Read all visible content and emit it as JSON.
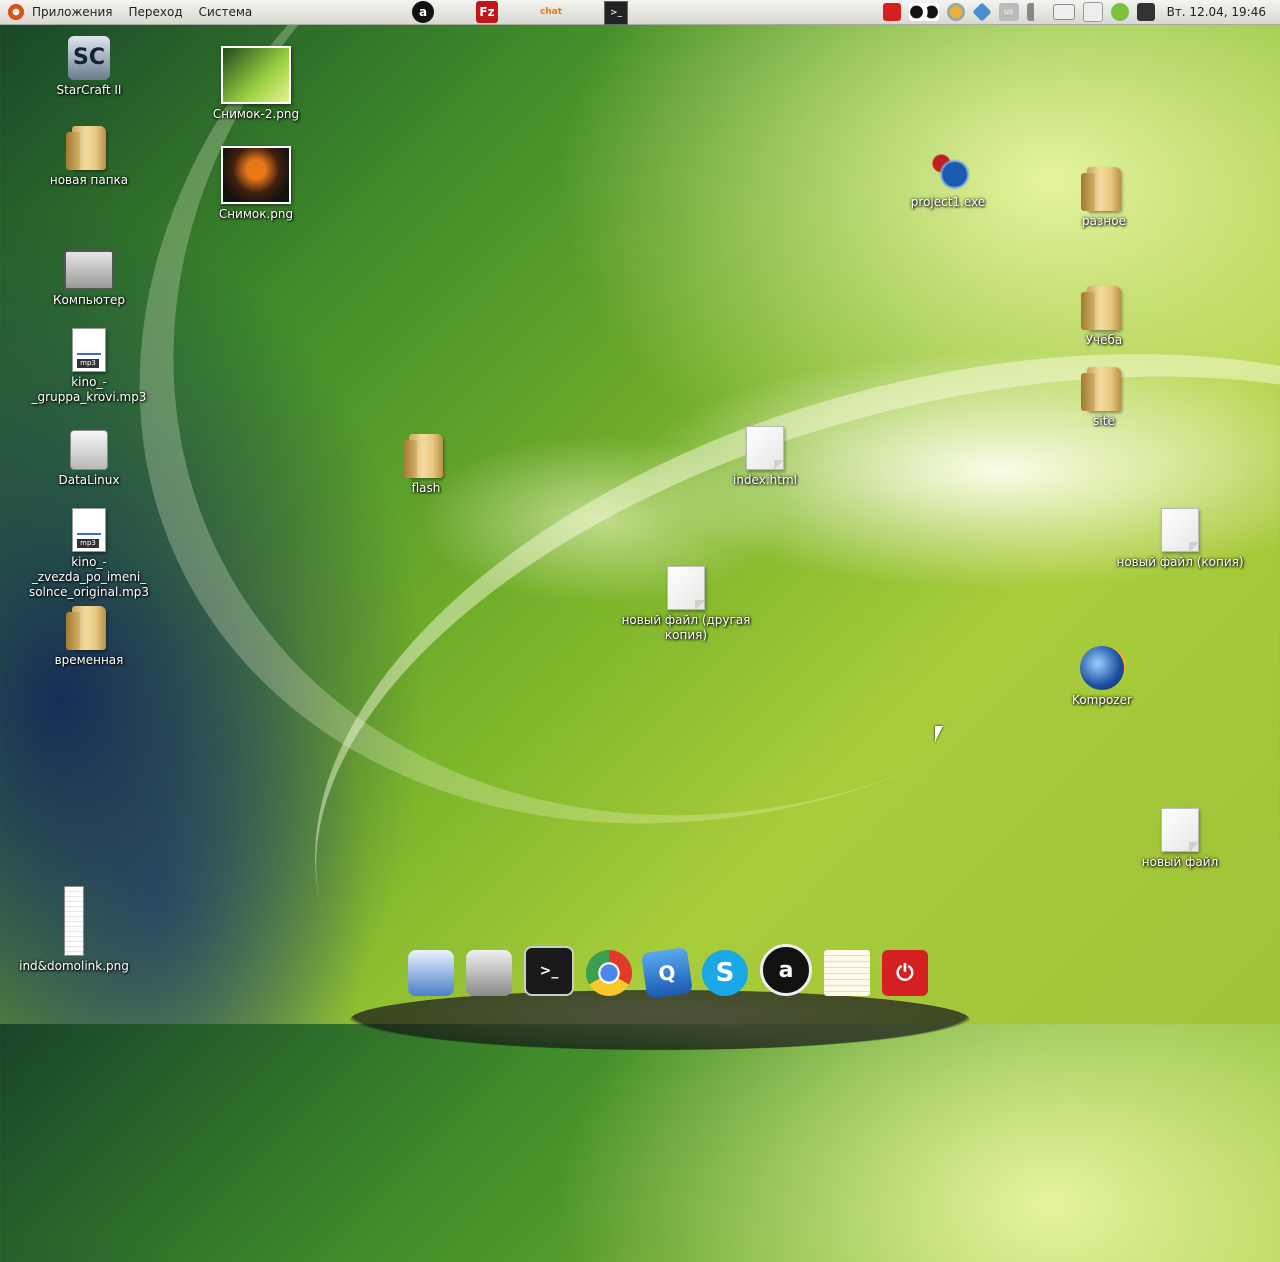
{
  "panel": {
    "menu": [
      "Приложения",
      "Переход",
      "Система"
    ],
    "clock": "Вт. 12.04, 19:46",
    "keyboard_layout": "us"
  },
  "desktop_icons": {
    "starcraft": "StarCraft II",
    "snimok2": "Снимок-2.png",
    "snimok": "Снимок.png",
    "new_folder": "новая папка",
    "computer": "Компьютер",
    "kino1": "kino_-_gruppa_krovi.mp3",
    "datalinux": "DataLinux",
    "kino2": "kino_-_zvezda_po_imeni_ solnce_original.mp3",
    "temp": "временная",
    "domolink": "ind&domolink.png",
    "flash": "flash",
    "index": "index.html",
    "new_file_other_copy": "новый файл (другая копия)",
    "project1": "project1.exe",
    "raznoe": "разное",
    "ucheba": "Учёба",
    "site": "site",
    "new_file_copy": "новый файл (копия)",
    "kompozer": "Kompozer",
    "new_file": "новый файл"
  },
  "dock_items": [
    "files-icon",
    "computer-icon",
    "terminal-icon",
    "chrome-icon",
    "qip-icon",
    "skype-icon",
    "aimp-icon",
    "text-editor-icon",
    "shutdown-icon"
  ]
}
